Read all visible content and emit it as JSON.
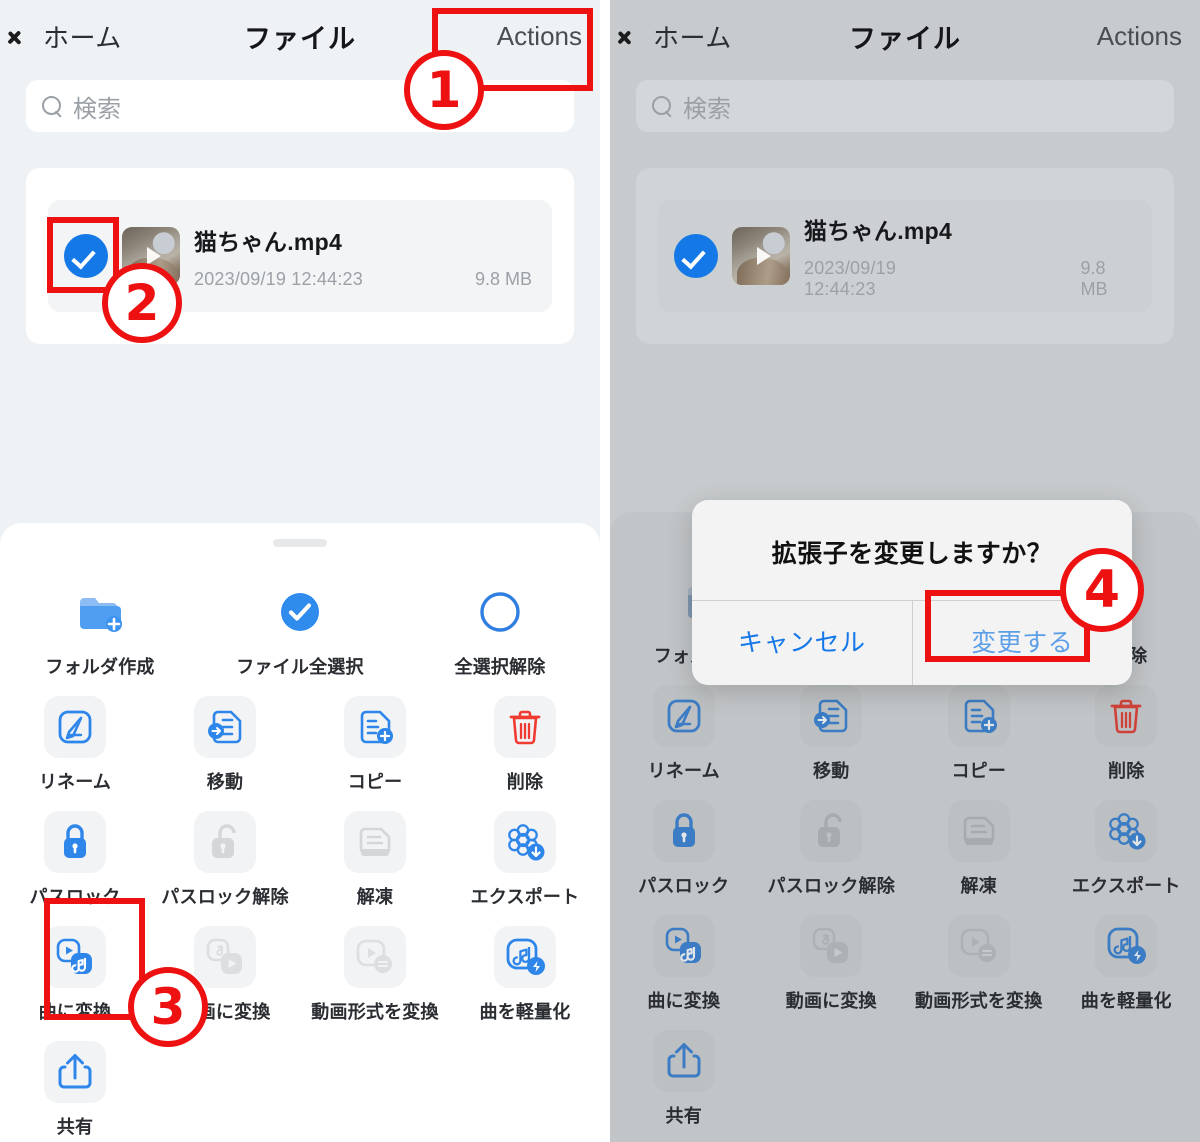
{
  "nav": {
    "back_label": "ホーム",
    "title": "ファイル",
    "action_label": "Actions"
  },
  "search": {
    "placeholder": "検索"
  },
  "file": {
    "name": "猫ちゃん.mp4",
    "date": "2023/09/19 12:44:23",
    "size": "9.8 MB",
    "selected": true
  },
  "sheet": {
    "row1": [
      {
        "label": "フォルダ作成",
        "icon": "folder-add-icon",
        "state": "active",
        "boxed": false
      },
      {
        "label": "ファイル全選択",
        "icon": "check-circle-filled-icon",
        "state": "active",
        "boxed": false
      },
      {
        "label": "全選択解除",
        "icon": "circle-outline-icon",
        "state": "active",
        "boxed": false
      }
    ],
    "row2": [
      {
        "label": "リネーム",
        "icon": "rename-pencil-icon",
        "state": "active"
      },
      {
        "label": "移動",
        "icon": "move-file-icon",
        "state": "active"
      },
      {
        "label": "コピー",
        "icon": "copy-file-add-icon",
        "state": "active"
      },
      {
        "label": "削除",
        "icon": "trash-icon",
        "state": "danger"
      }
    ],
    "row3": [
      {
        "label": "パスロック",
        "icon": "lock-closed-icon",
        "state": "active"
      },
      {
        "label": "パスロック解除",
        "icon": "lock-open-icon",
        "state": "disabled"
      },
      {
        "label": "解凍",
        "icon": "unarchive-icon",
        "state": "disabled"
      },
      {
        "label": "エクスポート",
        "icon": "export-cloud-download-icon",
        "state": "active"
      }
    ],
    "row4": [
      {
        "label": "曲に変換",
        "icon": "video-to-music-icon",
        "state": "active"
      },
      {
        "label": "動画に変換",
        "icon": "music-to-video-icon",
        "state": "disabled"
      },
      {
        "label": "動画形式を変換",
        "icon": "video-format-convert-icon",
        "state": "disabled"
      },
      {
        "label": "曲を軽量化",
        "icon": "music-compress-icon",
        "state": "active"
      }
    ],
    "row5": [
      {
        "label": "共有",
        "icon": "share-upload-icon",
        "state": "active",
        "boxed": false
      }
    ]
  },
  "alert": {
    "title": "拡張子を変更しますか？",
    "cancel_label": "キャンセル",
    "confirm_label": "変更する"
  },
  "annotations": {
    "markers": [
      "1",
      "2",
      "3",
      "4"
    ],
    "accent_color": "#ee1111"
  }
}
